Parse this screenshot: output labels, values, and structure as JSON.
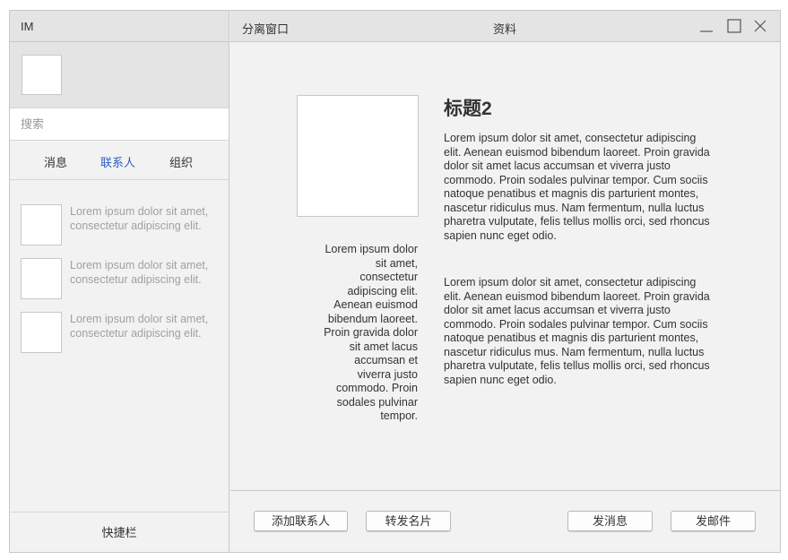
{
  "sidebar": {
    "title": "IM",
    "search": {
      "placeholder": "搜索",
      "value": ""
    },
    "tabs": [
      {
        "label": "消息",
        "active": false
      },
      {
        "label": "联系人",
        "active": true
      },
      {
        "label": "组织",
        "active": false
      }
    ],
    "contacts": [
      {
        "text": "Lorem ipsum dolor sit amet, consectetur adipiscing elit."
      },
      {
        "text": "Lorem ipsum dolor sit amet, consectetur adipiscing elit."
      },
      {
        "text": "Lorem ipsum dolor sit amet, consectetur adipiscing elit."
      }
    ],
    "shortcut_label": "快捷栏"
  },
  "main": {
    "detach_label": "分离窗口",
    "window_title": "资料",
    "avatar_caption": "Lorem ipsum dolor sit amet, consectetur adipiscing elit. Aenean euismod bibendum laoreet. Proin gravida dolor sit amet lacus accumsan et viverra justo commodo. Proin sodales pulvinar tempor.",
    "headline": "标题2",
    "paragraphs": [
      "Lorem ipsum dolor sit amet, consectetur adipiscing elit. Aenean euismod bibendum laoreet. Proin gravida dolor sit amet lacus accumsan et viverra justo commodo. Proin sodales pulvinar tempor. Cum sociis natoque penatibus et magnis dis parturient montes, nascetur ridiculus mus. Nam fermentum, nulla luctus pharetra vulputate, felis tellus mollis orci, sed rhoncus sapien nunc eget odio.",
      "Lorem ipsum dolor sit amet, consectetur adipiscing elit. Aenean euismod bibendum laoreet. Proin gravida dolor sit amet lacus accumsan et viverra justo commodo. Proin sodales pulvinar tempor. Cum sociis natoque penatibus et magnis dis parturient montes, nascetur ridiculus mus. Nam fermentum, nulla luctus pharetra vulputate, felis tellus mollis orci, sed rhoncus sapien nunc eget odio."
    ],
    "buttons": {
      "add_contact": "添加联系人",
      "forward_card": "转发名片",
      "send_message": "发消息",
      "send_mail": "发邮件"
    }
  },
  "colors": {
    "accent": "#2b5fc7",
    "chrome": "#e4e4e4",
    "background": "#f2f2f2",
    "muted_text": "#a0a0a0"
  },
  "icons": {
    "minimize": "minimize-icon",
    "maximize": "maximize-icon",
    "close": "close-icon"
  }
}
